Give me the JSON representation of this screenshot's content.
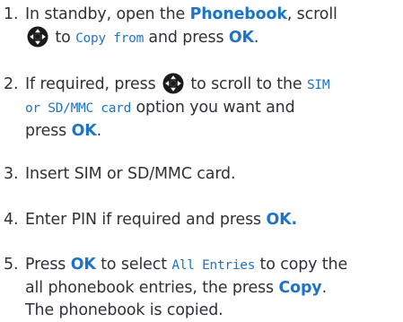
{
  "colors": {
    "keyword": "#1f73c6",
    "text": "#2e3238",
    "icon_dark": "#1a1a1a"
  },
  "icons": {
    "nav_key": "navigation-key-icon"
  },
  "steps": [
    {
      "number": "1.",
      "line1_a": "In standby, open the ",
      "line1_kw": "Phonebook",
      "line1_b": ", scroll",
      "line2_a": " to ",
      "line2_disp": "Copy from",
      "line2_b": " and press ",
      "line2_kw": "OK",
      "line2_c": "."
    },
    {
      "number": "2.",
      "line1_a": "If required, press ",
      "line1_b": " to scroll to the ",
      "line1_disp": "SIM",
      "line2_disp": "or SD/MMC card",
      "line2_b": " option you want and",
      "line3_a": "press ",
      "line3_kw": "OK",
      "line3_b": "."
    },
    {
      "number": "3.",
      "line1_a": "Insert SIM or SD/MMC card."
    },
    {
      "number": "4.",
      "line1_a": "Enter PIN if required and press ",
      "line1_kw": "OK."
    },
    {
      "number": "5.",
      "line1_a": "Press ",
      "line1_kw": "OK",
      "line1_b": " to select ",
      "line1_disp": "All Entries",
      "line1_c": " to copy the",
      "line2_a": "all phonebook entries, the press ",
      "line2_kw": "Copy",
      "line2_b": ".",
      "line3_a": "The phonebook is copied."
    }
  ]
}
